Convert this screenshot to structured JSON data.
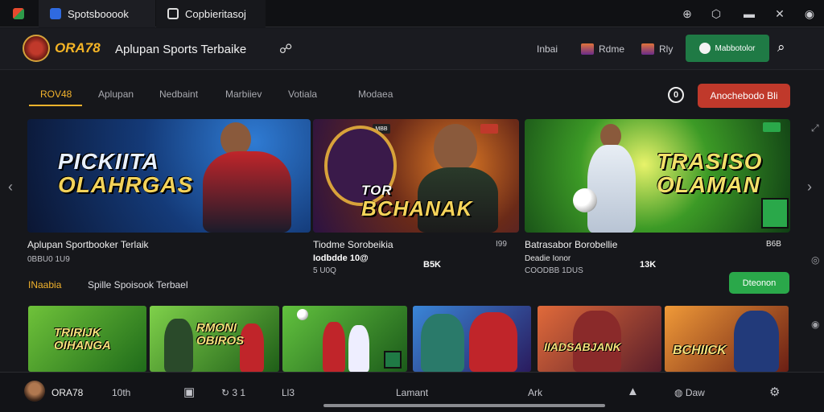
{
  "chrome": {
    "tabs": [
      {
        "label": "Spotsbooook"
      },
      {
        "label": "Copbieritasoj"
      }
    ],
    "icons": [
      "zoom-icon",
      "share-icon",
      "minimize-icon",
      "pin-icon",
      "profile-icon"
    ]
  },
  "header": {
    "brand": "ORA78",
    "tagline": "Aplupan Sports Terbaike",
    "links": [
      {
        "label": "Inbai"
      },
      {
        "label": "Rdme"
      },
      {
        "label": "Rly"
      }
    ],
    "cta": "Mabbotolor"
  },
  "nav": {
    "tabs": [
      {
        "label": "ROV48",
        "active": true
      },
      {
        "label": "Aplupan"
      },
      {
        "label": "Nedbaint"
      },
      {
        "label": "Marbiiev"
      },
      {
        "label": "Votiala"
      },
      {
        "label": "Modaea"
      }
    ],
    "info_icon": "0",
    "red_button": "Anochebodo Bli"
  },
  "banners": [
    {
      "title_line1": "PICKIITA",
      "title_line2": "OLAHRGAS",
      "caption": "Aplupan Sportbooker Terlaik",
      "sub": "0BBU0 1U9"
    },
    {
      "badge": "MBB",
      "title_line1": "TOR",
      "title_line2": "BCHANAK",
      "caption": "Tiodme Sorobeikia",
      "sub1": "Iodbdde 10@",
      "sub2": "5 U0Q",
      "side1": "I99",
      "side2": "B5K"
    },
    {
      "title_line1": "TRASISO",
      "title_line2": "OLAMAN",
      "caption": "Batrasabor Borobellie",
      "sub1": "Deadie Ionor",
      "sub2": "COODBB 1DUS",
      "side1": "B6B",
      "side2": "13K"
    }
  ],
  "section": {
    "label_left": "INaabia",
    "title": "Spille Spoisook Terbael",
    "button": "Dteonon"
  },
  "thumbs": [
    {
      "line1": "TRIRIJK",
      "line2": "OIHANGA"
    },
    {
      "line1": "RMONI",
      "line2": "OBIROS"
    },
    {
      "line1": "",
      "line2": ""
    },
    {
      "line1": "",
      "line2": ""
    },
    {
      "line1": "IIADSABJANK",
      "line2": ""
    },
    {
      "line1": "BCHIICK",
      "line2": ""
    }
  ],
  "bottom": {
    "brand": "ORA78",
    "count": "10th",
    "items": [
      {
        "label": "3 1"
      },
      {
        "label": "Ll3"
      },
      {
        "label": "Lamant"
      },
      {
        "label": "Ark"
      },
      {
        "label": "Daw"
      }
    ]
  },
  "colors": {
    "accent": "#f3b32c",
    "green": "#1f7a45",
    "red": "#c0392b",
    "background": "#16171b"
  }
}
